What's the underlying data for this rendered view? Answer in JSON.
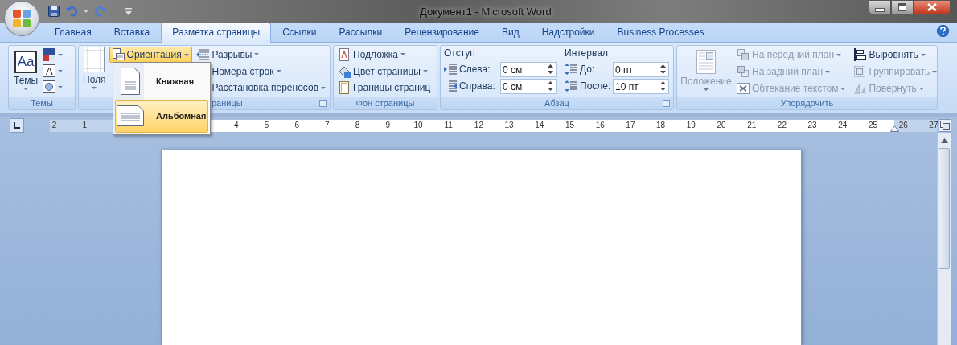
{
  "window": {
    "title": "Документ1 - Microsoft Word"
  },
  "tabs": [
    {
      "label": "Главная",
      "selected": false
    },
    {
      "label": "Вставка",
      "selected": false
    },
    {
      "label": "Разметка страницы",
      "selected": true
    },
    {
      "label": "Ссылки",
      "selected": false
    },
    {
      "label": "Рассылки",
      "selected": false
    },
    {
      "label": "Рецензирование",
      "selected": false
    },
    {
      "label": "Вид",
      "selected": false
    },
    {
      "label": "Надстройки",
      "selected": false
    },
    {
      "label": "Business Processes",
      "selected": false
    }
  ],
  "themes": {
    "label": "Темы",
    "button": "Темы",
    "big_icon_text": "Aa",
    "fonts_icon_text": "A"
  },
  "page_setup": {
    "label": "раницы",
    "margins_button": "Поля",
    "orientation_button": {
      "label": "Ориентация",
      "open": true
    },
    "commands": [
      {
        "label": "Разрывы",
        "has_menu": true
      },
      {
        "label": "Номера строк",
        "has_menu": true
      },
      {
        "label": "Расстановка переносов",
        "has_menu": true
      }
    ]
  },
  "orientation_menu": [
    {
      "label": "Книжная",
      "selected": false
    },
    {
      "label": "Альбомная",
      "selected": true
    }
  ],
  "page_background": {
    "label": "Фон страницы",
    "commands": [
      {
        "label": "Подложка",
        "has_menu": true
      },
      {
        "label": "Цвет страницы",
        "has_menu": true
      },
      {
        "label": "Границы страниц",
        "has_menu": false
      }
    ]
  },
  "paragraph": {
    "label": "Абзац",
    "indent": {
      "title": "Отступ",
      "fields": [
        {
          "label": "Слева:",
          "value": "0 см"
        },
        {
          "label": "Справа:",
          "value": "0 см"
        }
      ]
    },
    "spacing": {
      "title": "Интервал",
      "fields": [
        {
          "label": "До:",
          "value": "0 пт"
        },
        {
          "label": "После:",
          "value": "10 пт"
        }
      ]
    }
  },
  "arrange": {
    "label": "Упорядочить",
    "position_button": {
      "label": "Положение",
      "disabled": true
    },
    "commands": [
      {
        "label": "На передний план",
        "disabled": true,
        "has_menu": true
      },
      {
        "label": "На задний план",
        "disabled": true,
        "has_menu": true
      },
      {
        "label": "Обтекание текстом",
        "disabled": true,
        "has_menu": true
      },
      {
        "label": "Выровнять",
        "disabled": false,
        "has_menu": true
      },
      {
        "label": "Группировать",
        "disabled": true,
        "has_menu": true
      },
      {
        "label": "Повернуть",
        "disabled": true,
        "has_menu": true
      }
    ]
  },
  "ruler": {
    "left_labels": [
      "2",
      "1"
    ],
    "right_labels": [
      "4",
      "5",
      "6",
      "7",
      "8",
      "9",
      "10",
      "11",
      "12",
      "13",
      "14",
      "15",
      "16",
      "17",
      "18",
      "19",
      "20",
      "21",
      "22",
      "23",
      "24",
      "25",
      "26",
      "27"
    ]
  }
}
